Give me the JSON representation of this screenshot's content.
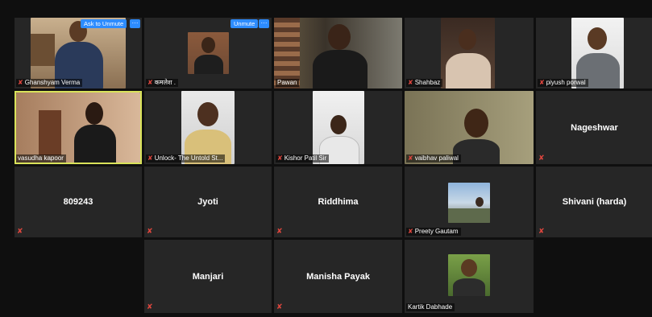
{
  "tiles": [
    {
      "name": "Ghanshyam Verma",
      "button": "Ask to Unmute",
      "more": "···"
    },
    {
      "name": "कमलेश .",
      "button": "Unmute",
      "more": "···"
    },
    {
      "name": "Pawan"
    },
    {
      "name": "Shahbaz"
    },
    {
      "name": "piyush porwal"
    },
    {
      "name": "vasudha kapoor"
    },
    {
      "name": "Unlock- The Untold St..."
    },
    {
      "name": "Kishor Patil Sir"
    },
    {
      "name": "vaibhav paliwal"
    },
    {
      "name": "Nageshwar"
    },
    {
      "name": "809243"
    },
    {
      "name": "Jyoti"
    },
    {
      "name": "Riddhima"
    },
    {
      "name": "Preety Gautam"
    },
    {
      "name": "Shivani (harda)"
    },
    {
      "name": "Manjari"
    },
    {
      "name": "Manisha Payak"
    },
    {
      "name": "Kartik Dabhade"
    }
  ],
  "icons": {
    "muted_mic": "muted-mic-icon"
  },
  "colors": {
    "accent": "#2d8cff",
    "active_border": "#d9e35a",
    "muted": "#e0463e"
  }
}
